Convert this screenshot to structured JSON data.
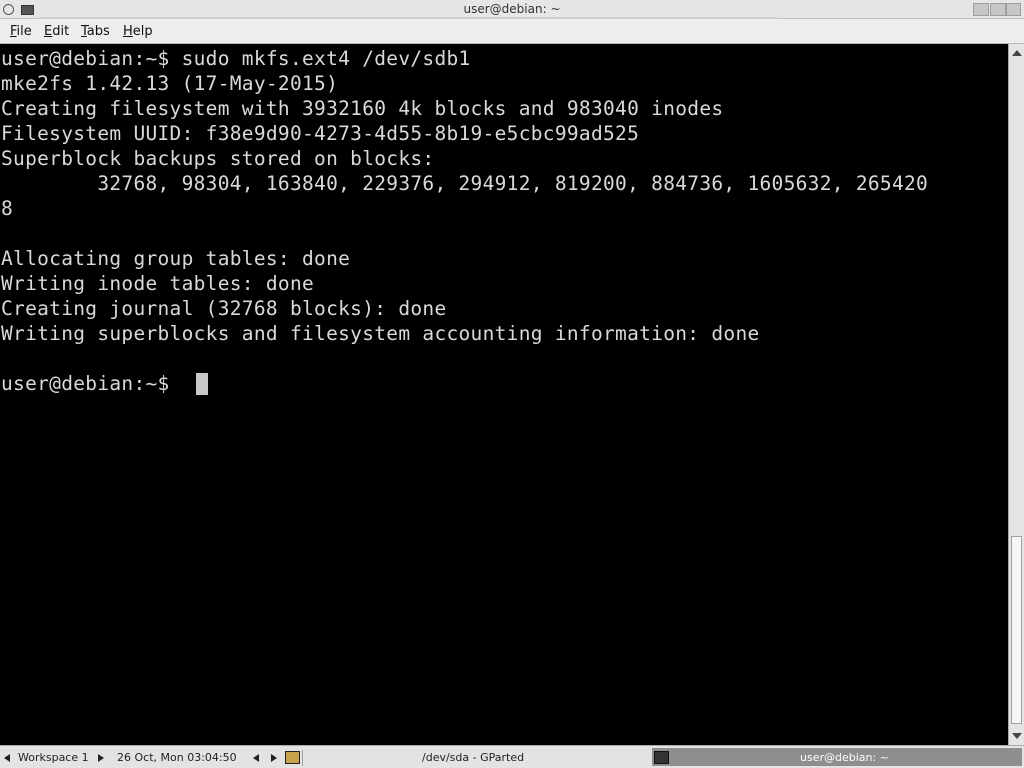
{
  "window": {
    "title": "user@debian: ~"
  },
  "menubar": {
    "file_u": "F",
    "file_rest": "ile",
    "edit_u": "E",
    "edit_rest": "dit",
    "tabs_u": "T",
    "tabs_rest": "abs",
    "help_u": "H",
    "help_rest": "elp"
  },
  "terminal": {
    "lines": [
      "user@debian:~$ sudo mkfs.ext4 /dev/sdb1",
      "mke2fs 1.42.13 (17-May-2015)",
      "Creating filesystem with 3932160 4k blocks and 983040 inodes",
      "Filesystem UUID: f38e9d90-4273-4d55-8b19-e5cbc99ad525",
      "Superblock backups stored on blocks:",
      "        32768, 98304, 163840, 229376, 294912, 819200, 884736, 1605632, 265420",
      "8",
      "",
      "Allocating group tables: done",
      "Writing inode tables: done",
      "Creating journal (32768 blocks): done",
      "Writing superblocks and filesystem accounting information: done",
      "",
      "user@debian:~$ "
    ]
  },
  "taskbar": {
    "workspace": "Workspace 1",
    "clock": "26 Oct, Mon 03:04:50",
    "task_gparted": "/dev/sda - GParted",
    "task_terminal": "user@debian: ~"
  }
}
